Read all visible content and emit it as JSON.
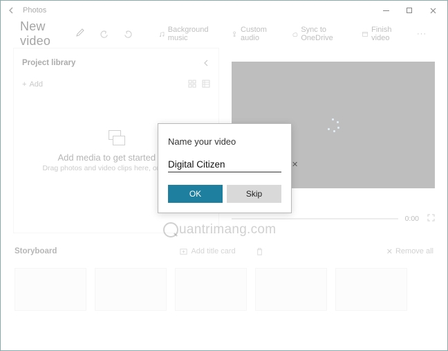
{
  "titlebar": {
    "app_name": "Photos"
  },
  "header": {
    "video_title": "New video",
    "bg_music": "Background music",
    "custom_audio": "Custom audio",
    "sync": "Sync to OneDrive",
    "finish": "Finish video"
  },
  "library": {
    "title": "Project library",
    "add": "Add",
    "empty_title": "Add media to get started now",
    "empty_sub": "Drag photos and video clips here, or click Add"
  },
  "preview": {
    "time": "0:00"
  },
  "storyboard": {
    "title": "Storyboard",
    "add_title": "Add title card",
    "remove_all": "Remove all"
  },
  "modal": {
    "heading": "Name your video",
    "value": "Digital Citizen",
    "ok": "OK",
    "skip": "Skip"
  },
  "watermark": "uantrimang.com"
}
